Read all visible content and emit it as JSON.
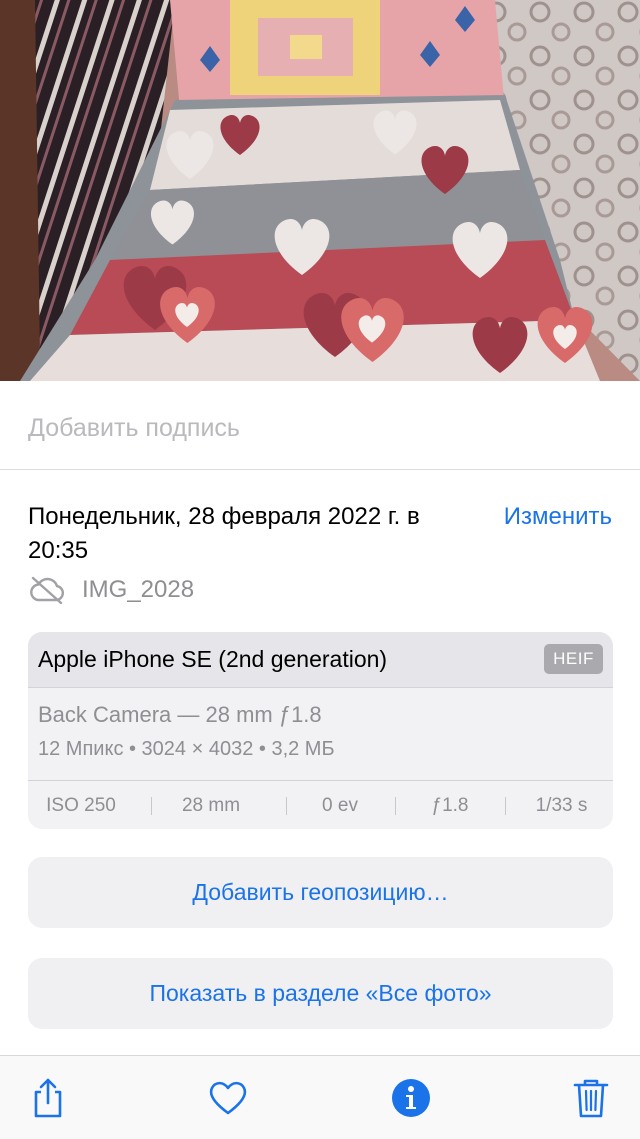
{
  "photo": {
    "name": "bed-with-heart-blanket-photo"
  },
  "caption": {
    "placeholder": "Добавить подпись"
  },
  "info": {
    "date_line": "Понедельник, 28 февраля 2022 г. в 20:35",
    "edit_label": "Изменить",
    "filename": "IMG_2028",
    "file_icon": "cloud-off-icon"
  },
  "camera": {
    "device": "Apple iPhone SE (2nd generation)",
    "format": "HEIF",
    "lens": "Back Camera — 28 mm ƒ1.8",
    "specs": "12 Мпикс • 3024 × 4032 • 3,2 МБ",
    "exif": {
      "iso": "ISO 250",
      "focal": "28 mm",
      "ev": "0 ev",
      "aperture": "ƒ1.8",
      "shutter": "1/33 s"
    }
  },
  "actions": {
    "add_location": "Добавить геопозицию…",
    "show_all_photos": "Показать в разделе «Все фото»"
  },
  "toolbar": {
    "items": [
      "share-icon",
      "heart-icon",
      "info-icon",
      "trash-icon"
    ],
    "accent": "#1a73e8"
  }
}
